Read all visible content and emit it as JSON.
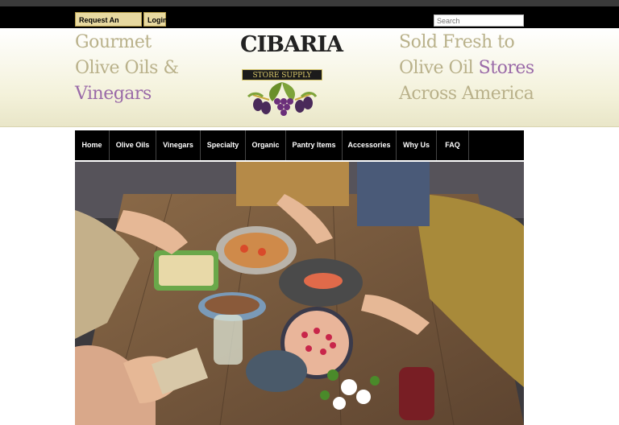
{
  "topbar": {
    "request_account": "Request An Account",
    "login": "Login",
    "search_placeholder": "Search"
  },
  "banner": {
    "left_line1": "Gourmet",
    "left_line2": "Olive Oils &",
    "left_line3": "Vinegars",
    "right_line1": "Sold Fresh to",
    "right_line2a": "Olive Oil ",
    "right_line2b": "Stores",
    "right_line3": "Across America",
    "logo_word": "CIBARIA",
    "logo_sub": "STORE SUPPLY"
  },
  "nav": {
    "items": [
      "Home",
      "Olive Oils",
      "Vinegars",
      "Specialty",
      "Organic",
      "Pantry Items",
      "Accessories",
      "Why Us",
      "FAQ"
    ]
  },
  "colors": {
    "tagline_beige": "#b9b18a",
    "tagline_purple": "#9a6aa8",
    "nav_bg": "#000000",
    "button_gold": "#e8d9a0"
  }
}
